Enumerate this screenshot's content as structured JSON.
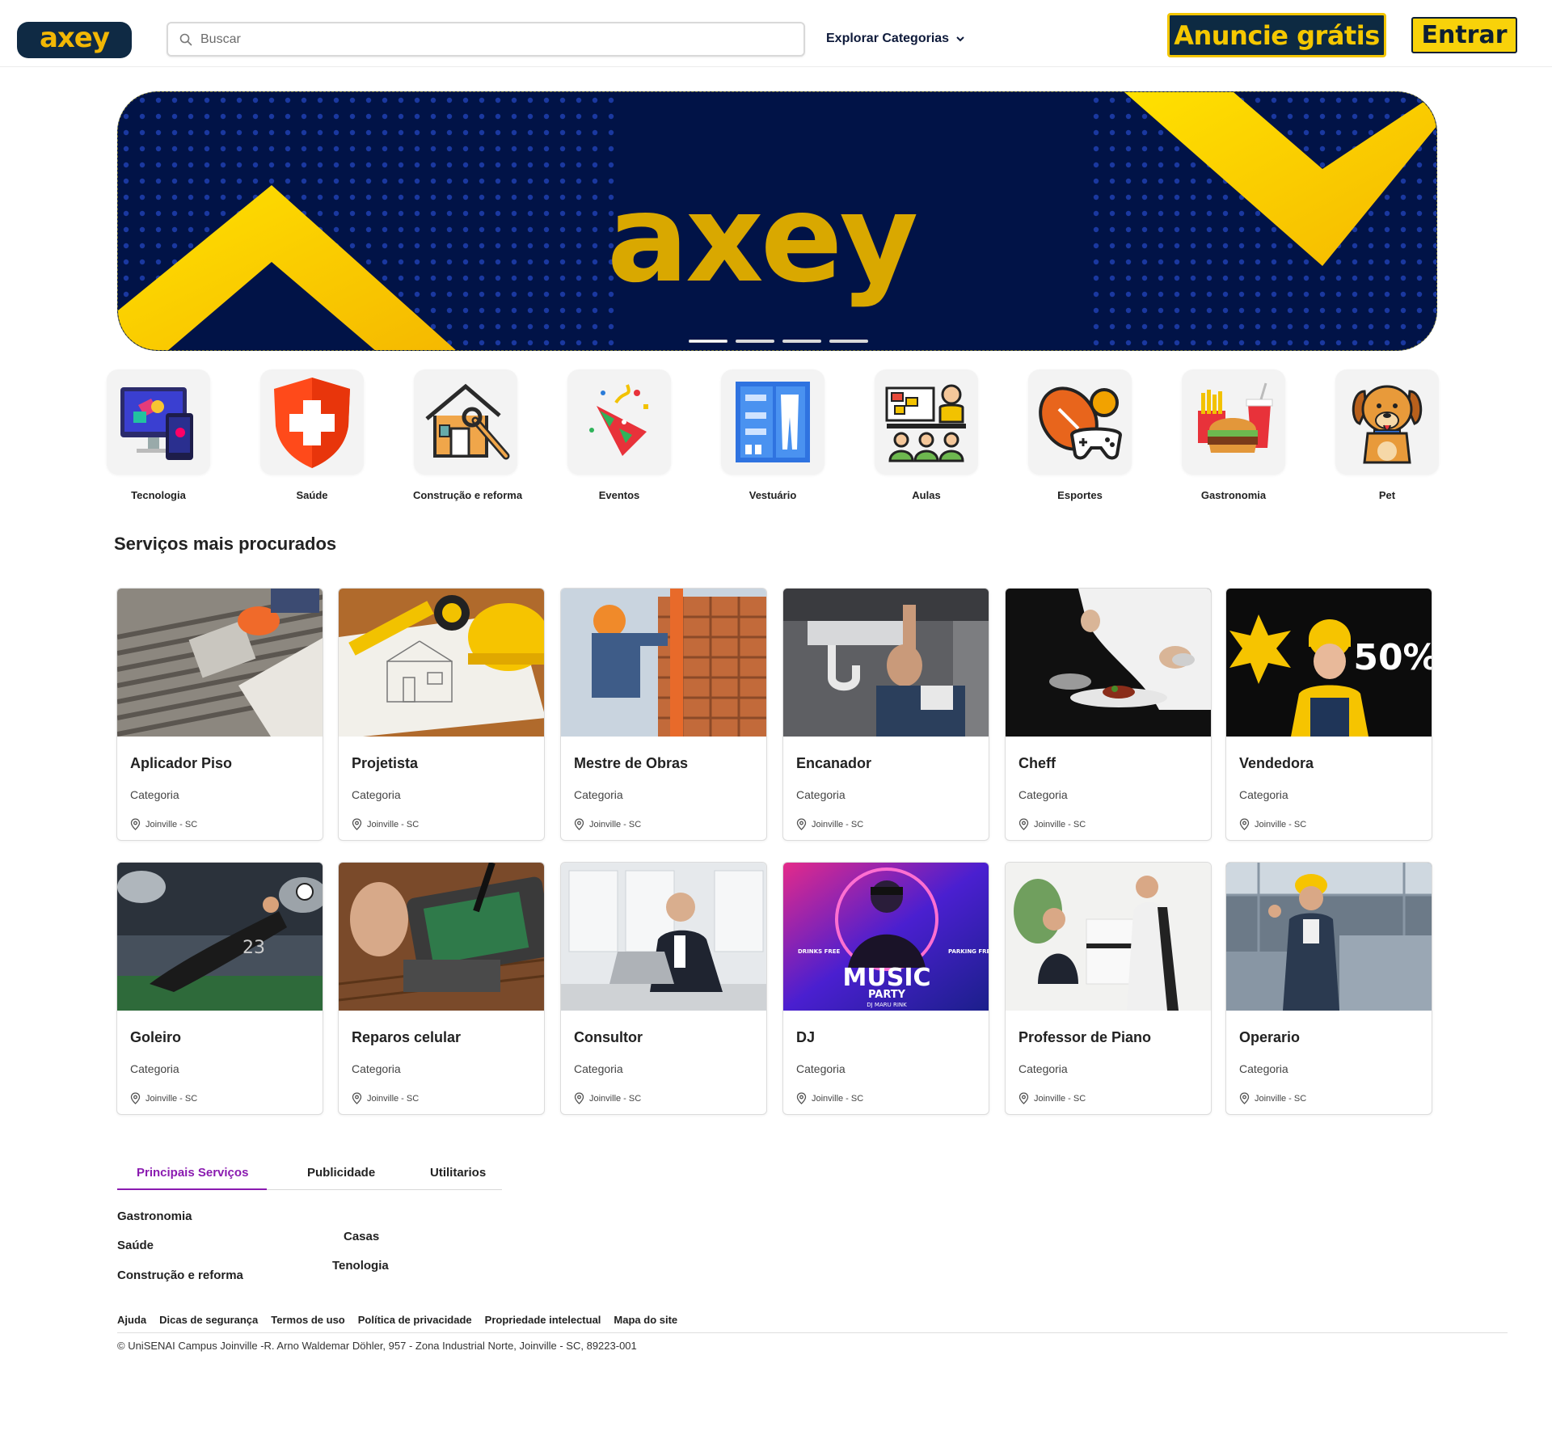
{
  "header": {
    "logo_text": "axey",
    "search_placeholder": "Buscar",
    "explore_label": "Explorar Categorias",
    "advertise_label": "Anuncie grátis",
    "login_label": "Entrar"
  },
  "banner": {
    "word": "axey",
    "slide_count": 4,
    "active_slide": 1
  },
  "categories": [
    {
      "label": "Tecnologia",
      "icon": "computer-devices-icon"
    },
    {
      "label": "Saúde",
      "icon": "health-shield-icon"
    },
    {
      "label": "Construção e reforma",
      "icon": "house-tools-icon"
    },
    {
      "label": "Eventos",
      "icon": "party-popper-icon"
    },
    {
      "label": "Vestuário",
      "icon": "wardrobe-icon"
    },
    {
      "label": "Aulas",
      "icon": "classroom-icon"
    },
    {
      "label": "Esportes",
      "icon": "sports-gamepad-icon"
    },
    {
      "label": "Gastronomia",
      "icon": "fast-food-icon"
    },
    {
      "label": "Pet",
      "icon": "dog-icon"
    }
  ],
  "section": {
    "title": "Serviços mais procurados"
  },
  "services": [
    {
      "title": "Aplicador Piso",
      "category": "Categoria",
      "location": "Joinville - SC",
      "image": "tile-installer-photo"
    },
    {
      "title": "Projetista",
      "category": "Categoria",
      "location": "Joinville - SC",
      "image": "blueprint-tools-photo"
    },
    {
      "title": "Mestre de Obras",
      "category": "Categoria",
      "location": "Joinville - SC",
      "image": "bricklayer-photo"
    },
    {
      "title": "Encanador",
      "category": "Categoria",
      "location": "Joinville - SC",
      "image": "plumber-photo"
    },
    {
      "title": "Cheff",
      "category": "Categoria",
      "location": "Joinville - SC",
      "image": "chef-plating-photo"
    },
    {
      "title": "Vendedora",
      "category": "Categoria",
      "location": "Joinville - SC",
      "image": "sale-50-photo",
      "sale_text": "50%"
    },
    {
      "title": "Goleiro",
      "category": "Categoria",
      "location": "Joinville - SC",
      "image": "goalkeeper-photo"
    },
    {
      "title": "Reparos celular",
      "category": "Categoria",
      "location": "Joinville - SC",
      "image": "phone-repair-photo"
    },
    {
      "title": "Consultor",
      "category": "Categoria",
      "location": "Joinville - SC",
      "image": "consultant-laptop-photo"
    },
    {
      "title": "DJ",
      "category": "Categoria",
      "location": "Joinville - SC",
      "image": "music-party-poster",
      "poster_title": "MUSIC",
      "poster_subtitle": "PARTY",
      "poster_dj": "DJ MARU RINK",
      "poster_left": "DRINKS FREE",
      "poster_right": "PARKING FREE"
    },
    {
      "title": "Professor de Piano",
      "category": "Categoria",
      "location": "Joinville - SC",
      "image": "piano-lesson-photo"
    },
    {
      "title": "Operario",
      "category": "Categoria",
      "location": "Joinville - SC",
      "image": "factory-worker-photo"
    }
  ],
  "footer": {
    "tabs": [
      "Principais Serviços",
      "Publicidade",
      "Utilitarios"
    ],
    "active_tab": 0,
    "col1": [
      "Gastronomia",
      "Saúde",
      "Construção e reforma"
    ],
    "col2": [
      "Casas",
      "Tenologia"
    ],
    "links": [
      "Ajuda",
      "Dicas de segurança",
      "Termos de uso",
      "Política de privacidade",
      "Propriedade intelectual",
      "Mapa do site"
    ],
    "copyright": "© UniSENAI Campus Joinville -R. Arno Waldemar Döhler, 957 - Zona Industrial Norte, Joinville - SC, 89223-001"
  },
  "colors": {
    "brand_navy": "#0f2a44",
    "brand_yellow": "#f5c800",
    "banner_bg": "#011347",
    "tab_active": "#8a1bb0"
  }
}
